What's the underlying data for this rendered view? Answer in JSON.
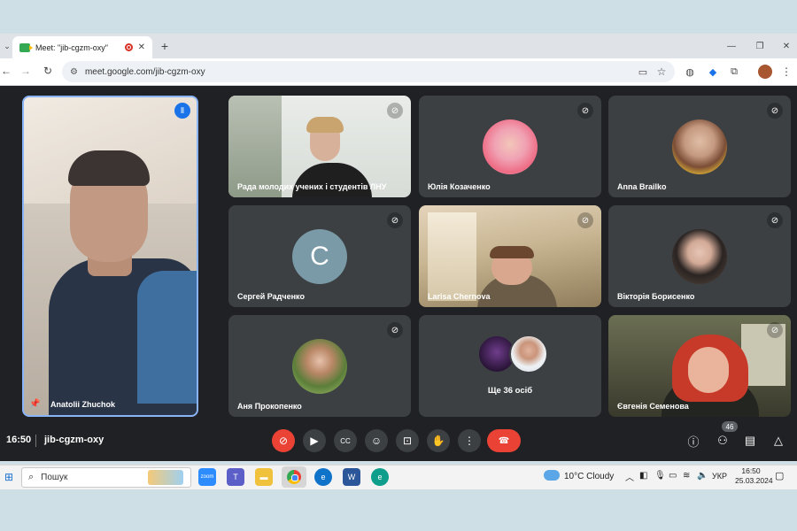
{
  "browser": {
    "tab_title": "Meet: \"jib-cgzm-oxy\"",
    "new_tab_symbol": "+",
    "url": "meet.google.com/jib-cgzm-oxy",
    "window_controls": [
      "—",
      "❐",
      "✕"
    ]
  },
  "meet": {
    "time": "16:50",
    "meeting_code": "jib-cgzm-oxy",
    "participants_count": "46",
    "presenter": {
      "name": "Anatolii Zhuchok",
      "avatar": "video-feed"
    },
    "tiles": [
      {
        "name": "Рада молодих учених і студентів ЛНУ",
        "avatar": "video-feed"
      },
      {
        "name": "Юлія Козаченко",
        "avatar": "photo"
      },
      {
        "name": "Anna Brailko",
        "avatar": "photo"
      },
      {
        "name": "Сергей Радченко",
        "initial": "C",
        "avatar": "letter"
      },
      {
        "name": "Larisa Chernova",
        "avatar": "video-feed"
      },
      {
        "name": "Вікторія Борисенко",
        "avatar": "photo"
      },
      {
        "name": "Аня Прокопенко",
        "avatar": "photo"
      },
      {
        "name": "Ще 36 осіб",
        "avatar": "group"
      },
      {
        "name": "Євгенія Семенова",
        "avatar": "video-feed"
      }
    ],
    "controls": [
      "mic-off-icon",
      "camera-icon",
      "captions-icon",
      "emoji-icon",
      "present-icon",
      "raise-hand-icon",
      "more-icon",
      "leave-call-icon"
    ],
    "colors": {
      "background": "#202124",
      "tile": "#3c4043",
      "danger": "#ea4335",
      "accent_border": "#8ab4f8"
    }
  },
  "taskbar": {
    "search_placeholder": "Пошук",
    "weather": "10°C  Cloudy",
    "language": "УКР",
    "clock_time": "16:50",
    "clock_date": "25.03.2024",
    "zoom_label": "zoom"
  }
}
